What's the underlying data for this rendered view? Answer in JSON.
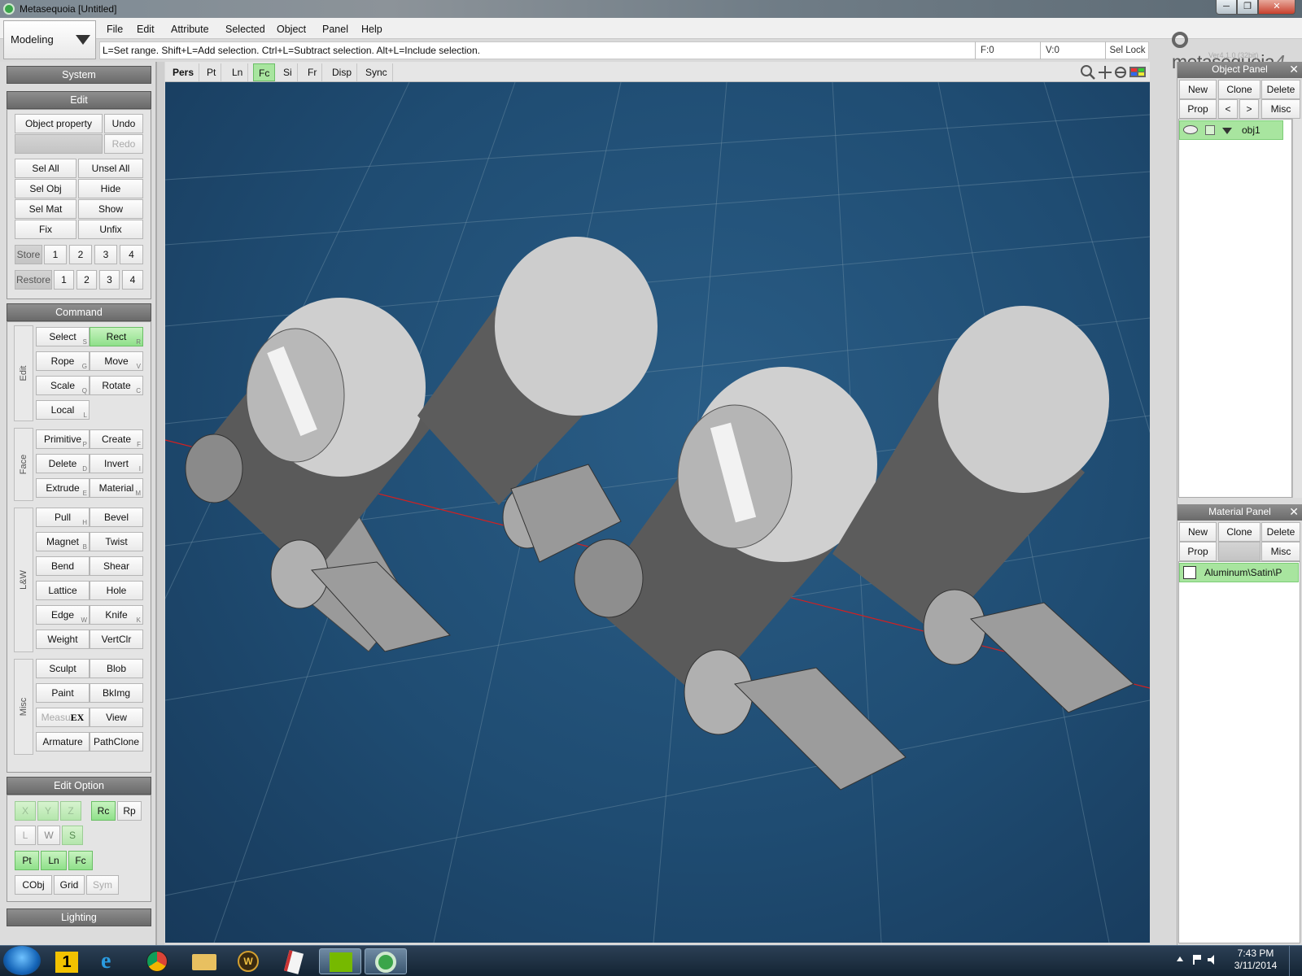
{
  "window": {
    "title": "Metasequoia [Untitled]",
    "min": "─",
    "max": "❐",
    "close": "✕"
  },
  "mode": {
    "value": "Modeling"
  },
  "menu": [
    "File",
    "Edit",
    "Attribute",
    "Selected",
    "Object",
    "Panel",
    "Help"
  ],
  "hint": "L=Set range.  Shift+L=Add selection.  Ctrl+L=Subtract selection.  Alt+L=Include selection.",
  "status": {
    "f": "F:0",
    "v": "V:0",
    "sel_lock": "Sel Lock"
  },
  "logo": {
    "name": "metasequoia",
    "num": "4",
    "version": "Ver4.1.0 (32bit)"
  },
  "sections": {
    "system": "System",
    "edit": "Edit",
    "command": "Command",
    "edit_option": "Edit Option",
    "lighting": "Lighting"
  },
  "edit": {
    "object_property": "Object property",
    "undo": "Undo",
    "redo": "Redo",
    "sel_all": "Sel All",
    "unsel_all": "Unsel All",
    "sel_obj": "Sel Obj",
    "hide": "Hide",
    "sel_mat": "Sel Mat",
    "show": "Show",
    "fix": "Fix",
    "unfix": "Unfix",
    "store": "Store",
    "restore": "Restore",
    "nums": [
      "1",
      "2",
      "3",
      "4"
    ]
  },
  "command": {
    "groups": {
      "edit": "Edit",
      "face": "Face",
      "lw": "L&W",
      "misc": "Misc"
    },
    "select": "Select",
    "rect": "Rect",
    "rope": "Rope",
    "move": "Move",
    "scale": "Scale",
    "rotate": "Rotate",
    "local": "Local",
    "primitive": "Primitive",
    "create": "Create",
    "delete": "Delete",
    "invert": "Invert",
    "extrude": "Extrude",
    "material": "Material",
    "pull": "Pull",
    "bevel": "Bevel",
    "magnet": "Magnet",
    "twist": "Twist",
    "bend": "Bend",
    "shear": "Shear",
    "lattice": "Lattice",
    "hole": "Hole",
    "edge": "Edge",
    "knife": "Knife",
    "weight": "Weight",
    "vertclr": "VertClr",
    "sculpt": "Sculpt",
    "blob": "Blob",
    "paint": "Paint",
    "bkimg": "BkImg",
    "measure": "Measu",
    "ex": "EX",
    "view": "View",
    "armature": "Armature",
    "pathclone": "PathClone",
    "sc": {
      "select": "S",
      "rect": "R",
      "rope": "G",
      "move": "V",
      "scale": "Q",
      "rotate": "C",
      "local": "L",
      "primitive": "P",
      "create": "F",
      "delete": "D",
      "invert": "I",
      "extrude": "E",
      "material": "M",
      "pull": "H",
      "magnet": "B",
      "edge": "W",
      "knife": "K"
    }
  },
  "edit_option": {
    "x": "X",
    "y": "Y",
    "z": "Z",
    "rc": "Rc",
    "rp": "Rp",
    "l": "L",
    "w": "W",
    "s": "S",
    "pt": "Pt",
    "ln": "Ln",
    "fc": "Fc",
    "cobj": "CObj",
    "grid": "Grid",
    "sym": "Sym"
  },
  "view_tabs": [
    "Pers",
    "Pt",
    "Ln",
    "Fc",
    "Si",
    "Fr",
    "Disp",
    "Sync"
  ],
  "object_panel": {
    "title": "Object Panel",
    "new": "New",
    "clone": "Clone",
    "delete": "Delete",
    "prop": "Prop",
    "prev": "<",
    "next": ">",
    "misc": "Misc",
    "item": "obj1"
  },
  "material_panel": {
    "title": "Material Panel",
    "new": "New",
    "clone": "Clone",
    "delete": "Delete",
    "prop": "Prop",
    "misc": "Misc",
    "item": "Aluminum\\Satin\\P"
  },
  "clock": {
    "time": "7:43 PM",
    "date": "3/11/2014"
  },
  "colors": {
    "active_green": "#a8e59f",
    "viewport_bg": "#1f4c72",
    "model_gray": "#8a8a8a"
  }
}
